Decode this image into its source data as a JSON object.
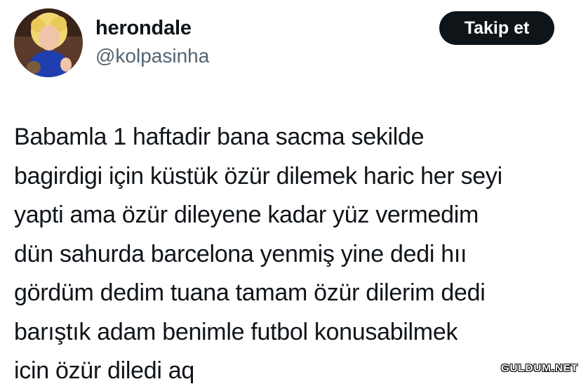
{
  "author": {
    "display_name": "herondale",
    "handle": "@kolpasinha"
  },
  "follow_button": {
    "label": "Takip et"
  },
  "tweet": {
    "lines": [
      "Babamla 1 haftadir bana sacma sekilde",
      "bagirdigi için küstük özür dilemek haric her seyi",
      "yapti ama özür dileyene kadar yüz vermedim",
      "dün sahurda barcelona yenmiş yine dedi hıı",
      "gördüm dedim tuana tamam özür dilerim dedi",
      "barıştık adam benimle futbol konusabilmek",
      "icin özür diledi aq"
    ]
  },
  "watermark": {
    "text": "GULDUM.NET"
  },
  "colors": {
    "text_primary": "#0f1419",
    "text_secondary": "#536471",
    "button_bg": "#0f1419",
    "button_text": "#ffffff"
  }
}
